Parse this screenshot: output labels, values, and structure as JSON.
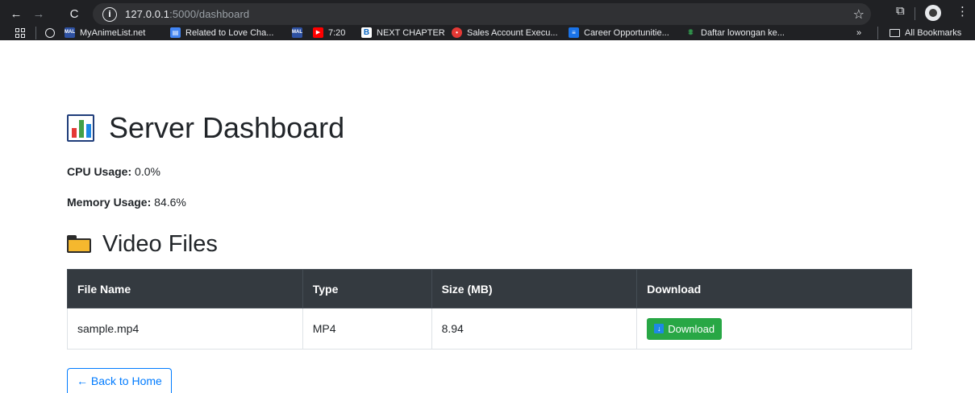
{
  "browser": {
    "url_host": "127.0.0.1",
    "url_path": ":5000/dashboard",
    "bookmarks": [
      {
        "label": "MyAnimeList.net",
        "favicon": "mal"
      },
      {
        "label": "Related to Love Cha...",
        "favicon": "doc"
      },
      {
        "label": "",
        "favicon": "mal"
      },
      {
        "label": "7:20",
        "favicon": "youtube"
      },
      {
        "label": "NEXT CHAPTER",
        "favicon": "bn"
      },
      {
        "label": "Sales Account Execu...",
        "favicon": "pin"
      },
      {
        "label": "Career Opportunitie...",
        "favicon": "career"
      },
      {
        "label": "Daftar lowongan ke...",
        "favicon": "daftar"
      }
    ],
    "overflow_label": "»",
    "all_bookmarks_label": "All Bookmarks"
  },
  "page": {
    "title": "Server Dashboard",
    "cpu_label": "CPU Usage:",
    "cpu_value": "0.0%",
    "memory_label": "Memory Usage:",
    "memory_value": "84.6%",
    "section_title": "Video Files"
  },
  "table": {
    "headers": [
      "File Name",
      "Type",
      "Size (MB)",
      "Download"
    ],
    "rows": [
      {
        "file_name": "sample.mp4",
        "type": "MP4",
        "size": "8.94",
        "download_label": "Download"
      }
    ]
  },
  "back_button_label": "← Back to Home",
  "colors": {
    "header_bg": "#343a40",
    "download_green": "#28a745",
    "link_blue": "#007bff"
  }
}
